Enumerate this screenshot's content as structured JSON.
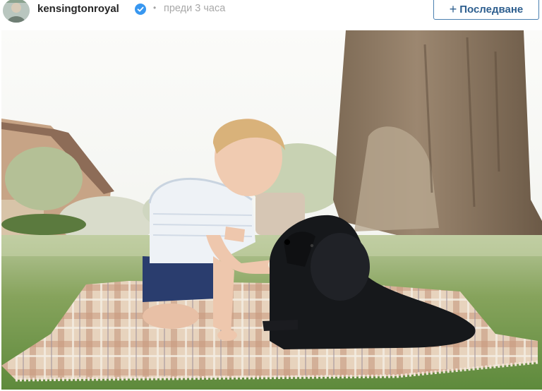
{
  "post_header": {
    "avatar_icon": "profile-avatar",
    "username": "kensingtonroyal",
    "verified_icon": "verified-badge-icon",
    "separator": "•",
    "time_ago": "преди 3 часа",
    "follow_label": "Последване",
    "follow_icon": "+"
  },
  "colors": {
    "verified_blue": "#3897f0",
    "follow_border": "#4a7fb0",
    "follow_text": "#2e5f8f"
  },
  "photo": {
    "subject": "child-with-dog-photo"
  }
}
